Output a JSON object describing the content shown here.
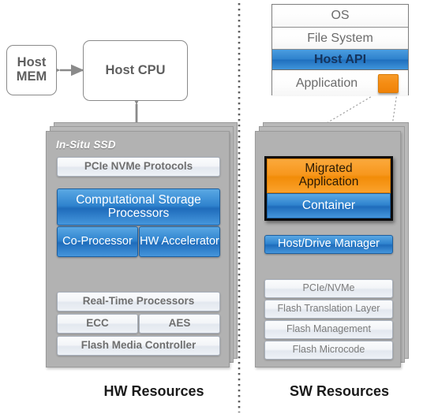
{
  "diagram": {
    "host": {
      "mem_label": "Host\nMEM",
      "mem_line1": "Host",
      "mem_line2": "MEM",
      "cpu_label": "Host CPU"
    },
    "os_stack": {
      "rows": [
        {
          "label": "OS",
          "style": "plain"
        },
        {
          "label": "File System",
          "style": "plain"
        },
        {
          "label": "Host API",
          "style": "highlight"
        },
        {
          "label": "Application",
          "style": "plain-with-chip"
        }
      ]
    },
    "hw_panel": {
      "title": "In-Situ SSD",
      "top_tile": "PCIe NVMe Protocols",
      "csp_label": "Computational Storage Processors",
      "csp_line1": "Computational Storage",
      "csp_line2": "Processors",
      "co_processor": "Co-Processor",
      "hw_accelerator": "HW Accelerator",
      "real_time": "Real-Time Processors",
      "ecc": "ECC",
      "aes": "AES",
      "flash_media_controller": "Flash Media Controller"
    },
    "sw_panel": {
      "migrated_line1": "Migrated",
      "migrated_line2": "Application",
      "container": "Container",
      "host_drive_manager": "Host/Drive Manager",
      "firmware_tiles": [
        "PCIe/NVMe",
        "Flash Translation Layer",
        "Flash Management",
        "Flash Microcode"
      ]
    },
    "captions": {
      "left": "HW Resources",
      "right": "SW Resources"
    },
    "colors": {
      "accent_blue": "#2f83ce",
      "accent_orange": "#f7971d",
      "panel_gray": "#b2b2b2",
      "arrow_gray": "#8a8a8a",
      "divider": "#6a6a6a",
      "frame_black": "#0d0d0d"
    }
  }
}
